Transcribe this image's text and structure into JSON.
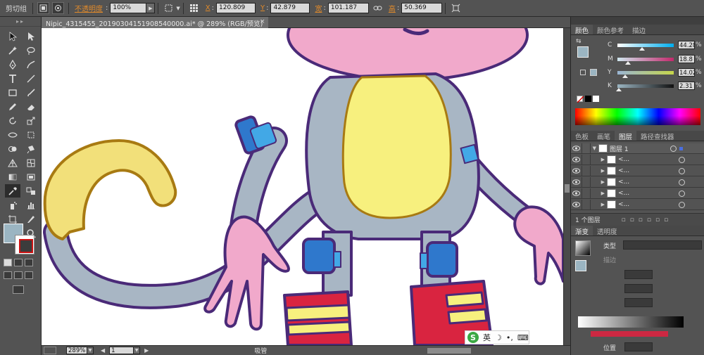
{
  "control_bar": {
    "group_label": "剪切组",
    "opacity_label": "不透明度",
    "opacity_value": "100%",
    "x_label": "X",
    "x_value": "120.809",
    "y_label": "Y",
    "y_value": "42.879",
    "width_label": "宽",
    "width_value": "101.187",
    "height_label": "高",
    "height_value": "50.369"
  },
  "document": {
    "tab_title": "Nipic_4315455_20190304151908540000.ai* @ 289% (RGB/预览)",
    "close_glyph": "×",
    "zoom": "289%",
    "artboard": "1",
    "status_text": "吸管"
  },
  "ime": {
    "logo": "S",
    "mode": "英",
    "moon": "☽",
    "dots": "•,",
    "keyboard": "⌨"
  },
  "color_panel": {
    "tabs": [
      "颜色",
      "颜色参考",
      "描边"
    ],
    "active_tab": 0,
    "fill_color": "#9bb5c2",
    "sliders": [
      {
        "label": "C",
        "value": "44.28",
        "fraction": 0.44
      },
      {
        "label": "M",
        "value": "18.8",
        "fraction": 0.19
      },
      {
        "label": "Y",
        "value": "14.02",
        "fraction": 0.14
      },
      {
        "label": "K",
        "value": "2.31",
        "fraction": 0.02
      }
    ],
    "percent": "%"
  },
  "layers_panel": {
    "tabs": [
      "色板",
      "画笔",
      "图层",
      "路径查找器"
    ],
    "active_tab": 2,
    "rows": [
      {
        "name": "图层 1",
        "level": 0,
        "selected": true
      },
      {
        "name": "<...",
        "level": 1,
        "selected": false
      },
      {
        "name": "<...",
        "level": 1,
        "selected": false
      },
      {
        "name": "<...",
        "level": 1,
        "selected": false
      },
      {
        "name": "<...",
        "level": 1,
        "selected": false
      },
      {
        "name": "<...",
        "level": 1,
        "selected": false
      }
    ],
    "footer_count": "1 个图层"
  },
  "gradient_panel": {
    "tabs": [
      "渐变",
      "透明度"
    ],
    "active_tab": 0,
    "type_label": "类型",
    "stroke_label": "描边",
    "position_label": "位置"
  },
  "colors": {
    "accent_orange": "#e08a2b",
    "monkey_gray": "#a8b6c4",
    "belly_yellow": "#f7f07e",
    "skin_pink": "#f1a9cb",
    "boot_red": "#d92440",
    "band_blue": "#2f78cc",
    "outline_purple": "#4a2a78",
    "tail_yellow": "#f2e07a"
  }
}
